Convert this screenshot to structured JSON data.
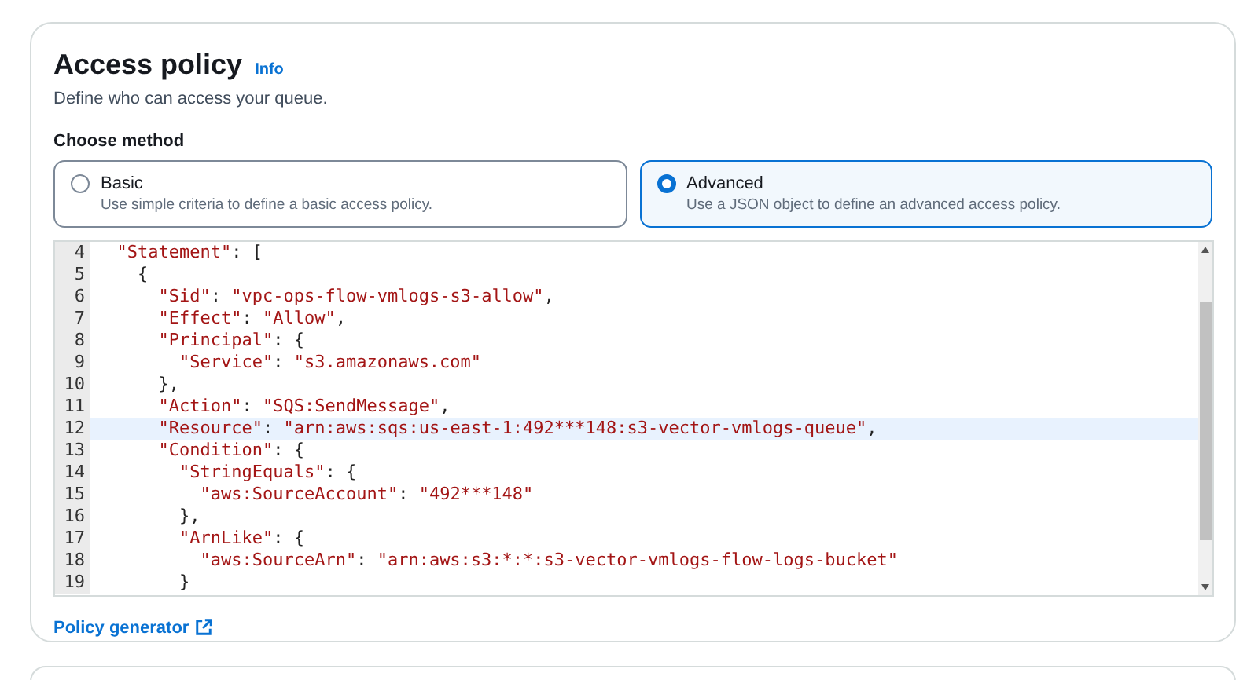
{
  "panel": {
    "title": "Access policy",
    "info_link": "Info",
    "description": "Define who can access your queue."
  },
  "method": {
    "label": "Choose method",
    "options": [
      {
        "label": "Basic",
        "description": "Use simple criteria to define a basic access policy.",
        "selected": false
      },
      {
        "label": "Advanced",
        "description": "Use a JSON object to define an advanced access policy.",
        "selected": true
      }
    ]
  },
  "editor": {
    "lines": [
      {
        "number": "4",
        "text": "  \"Statement\": [",
        "selected": false
      },
      {
        "number": "5",
        "text": "    {",
        "selected": false
      },
      {
        "number": "6",
        "text": "      \"Sid\": \"vpc-ops-flow-vmlogs-s3-allow\",",
        "selected": false
      },
      {
        "number": "7",
        "text": "      \"Effect\": \"Allow\",",
        "selected": false
      },
      {
        "number": "8",
        "text": "      \"Principal\": {",
        "selected": false
      },
      {
        "number": "9",
        "text": "        \"Service\": \"s3.amazonaws.com\"",
        "selected": false
      },
      {
        "number": "10",
        "text": "      },",
        "selected": false
      },
      {
        "number": "11",
        "text": "      \"Action\": \"SQS:SendMessage\",",
        "selected": false
      },
      {
        "number": "12",
        "text": "      \"Resource\": \"arn:aws:sqs:us-east-1:492***148:s3-vector-vmlogs-queue\",",
        "selected": true
      },
      {
        "number": "13",
        "text": "      \"Condition\": {",
        "selected": false
      },
      {
        "number": "14",
        "text": "        \"StringEquals\": {",
        "selected": false
      },
      {
        "number": "15",
        "text": "          \"aws:SourceAccount\": \"492***148\"",
        "selected": false
      },
      {
        "number": "16",
        "text": "        },",
        "selected": false
      },
      {
        "number": "17",
        "text": "        \"ArnLike\": {",
        "selected": false
      },
      {
        "number": "18",
        "text": "          \"aws:SourceArn\": \"arn:aws:s3:*:*:s3-vector-vmlogs-flow-logs-bucket\"",
        "selected": false
      },
      {
        "number": "19",
        "text": "        }",
        "selected": false
      }
    ]
  },
  "policy_generator_link": "Policy generator"
}
